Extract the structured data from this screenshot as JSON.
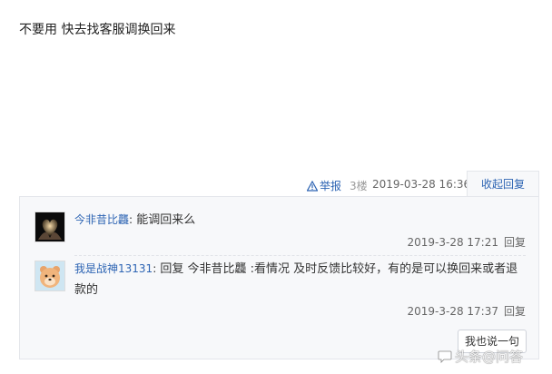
{
  "post": {
    "text": "不要用 快去找客服调换回来"
  },
  "meta": {
    "report_label": "举报",
    "floor": "3楼",
    "time": "2019-03-28 16:36",
    "collapse_reply_label": "收起回复"
  },
  "replies": [
    {
      "user": "今非昔比龘",
      "separator": ":",
      "content": " 能调回来么",
      "time": "2019-3-28 17:21",
      "reply_label": "回复"
    },
    {
      "user": "我是战神13131",
      "separator": ":",
      "reply_word": " 回复 ",
      "reply_to": "今非昔比龘",
      "content": " :看情况 及时反馈比较好，有的是可以换回来或者退款的",
      "time": "2019-3-28 17:37",
      "reply_label": "回复"
    }
  ],
  "say_button_label": "我也说一句",
  "watermark": "头条@问答",
  "colors": {
    "link": "#2d64b3",
    "panel_bg": "#f7f8fa",
    "border": "#e4e6eb"
  }
}
